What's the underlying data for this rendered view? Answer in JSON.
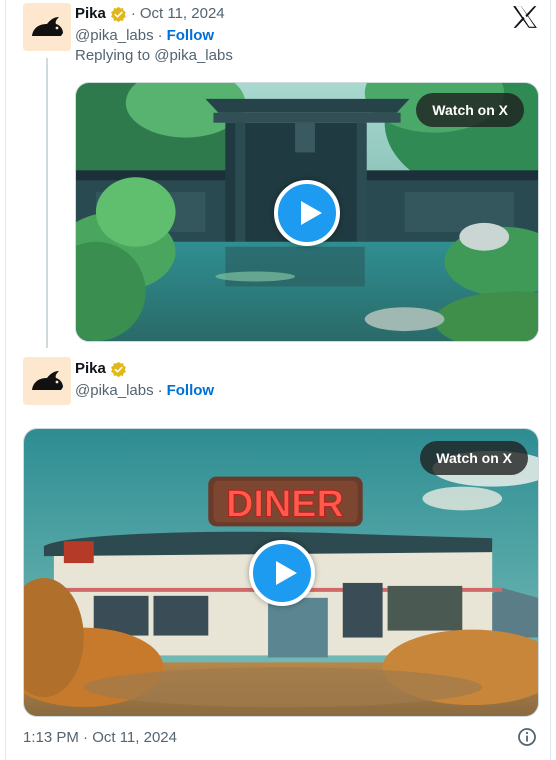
{
  "tweet1": {
    "author_name": "Pika",
    "date": "Oct 11, 2024",
    "handle": "@pika_labs",
    "follow_label": "Follow",
    "replying_to": "Replying to @pika_labs",
    "watch_label": "Watch on X"
  },
  "tweet2": {
    "author_name": "Pika",
    "handle": "@pika_labs",
    "follow_label": "Follow",
    "watch_label": "Watch on X",
    "media_sign_text": "DINER"
  },
  "footer": {
    "timestamp": "1:13 PM · Oct 11, 2024"
  },
  "separator": "·",
  "colors": {
    "link_blue": "#006fd6",
    "play_blue": "#1d9bf0",
    "muted_gray": "#536471",
    "verified_gold": "#e2b719",
    "avatar_bg": "#fde8cf"
  },
  "icons": {
    "verified": "verified-badge-icon",
    "x_logo": "x-logo-icon",
    "play": "play-icon",
    "info": "info-icon"
  }
}
